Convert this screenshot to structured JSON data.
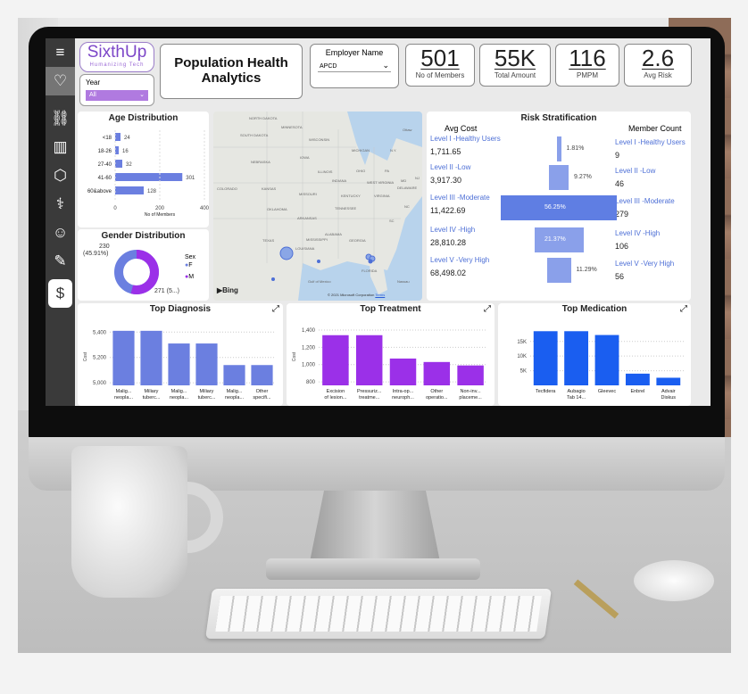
{
  "header": {
    "logo_text": "SixthUp",
    "logo_tagline": "Humanizing Tech",
    "title_line1": "Population Health",
    "title_line2": "Analytics",
    "year_label": "Year",
    "year_value": "All",
    "employer_label": "Employer Name",
    "employer_value": "APCD"
  },
  "kpis": [
    {
      "value": "501",
      "label": "No of Members"
    },
    {
      "value": "55K",
      "label": "Total Amount"
    },
    {
      "value": "116",
      "label": "PMPM"
    },
    {
      "value": "2.6",
      "label": "Avg Risk"
    }
  ],
  "sidebar": {
    "icons": [
      "menu-icon",
      "hand-heart-icon",
      "share-icon",
      "bar-chart-icon",
      "shield-icon",
      "stethoscope-icon",
      "doctor-icon",
      "notepad-icon",
      "money-bag-icon"
    ],
    "symbols": [
      "≡",
      "♡",
      "⛓",
      "▥",
      "⬡",
      "⚕",
      "☺",
      "✎",
      "$"
    ]
  },
  "age_chart": {
    "title": "Age Distribution",
    "xlabel": "No of Members",
    "ticks": [
      "0",
      "200",
      "400"
    ]
  },
  "gender_chart": {
    "title": "Gender Distribution",
    "label_f": "230",
    "label_f_pct": "(45.91%)",
    "label_m": "271 (5...)",
    "legend_title": "Sex",
    "legend_f": "F",
    "legend_m": "M"
  },
  "map": {
    "labels": [
      "NORTH DAKOTA",
      "MINNESOTA",
      "Ottaw",
      "SOUTH DAKOTA",
      "WISCONSIN",
      "MICHIGAN",
      "N.Y.",
      "IOWA",
      "NEBRASKA",
      "ILLINOIS",
      "OHIO",
      "PA",
      "INDIANA",
      "WEST VIRGINIA",
      "MD",
      "DELAWARE",
      "NJ",
      "COLORADO",
      "KANSAS",
      "MISSOURI",
      "KENTUCKY",
      "VIRGINIA",
      "NC",
      "TENNESSEE",
      "OKLAHOMA",
      "ARKANSAS",
      "SC",
      "ALABAMA",
      "TEXAS",
      "MISSISSIPPI",
      "GEORGIA",
      "LOUISIANA",
      "FLORIDA",
      "Gulf of Mexico",
      "Nassau"
    ],
    "bing": "Bing",
    "copyright": "© 2021 Microsoft Corporation",
    "terms": "Terms"
  },
  "risk": {
    "title": "Risk Stratification",
    "avg_cost_header": "Avg Cost",
    "member_count_header": "Member Count",
    "levels": [
      {
        "name": "Level I -Healthy Users",
        "cost": "1,711.65",
        "pct": "1.81%",
        "count": "9"
      },
      {
        "name": "Level II -Low",
        "cost": "3,917.30",
        "pct": "9.27%",
        "count": "46"
      },
      {
        "name": "Level III -Moderate",
        "cost": "11,422.69",
        "pct": "56.25%",
        "count": "279"
      },
      {
        "name": "Level IV -High",
        "cost": "28,810.28",
        "pct": "21.37%",
        "count": "106"
      },
      {
        "name": "Level V -Very High",
        "cost": "68,498.02",
        "pct": "11.29%",
        "count": "56"
      }
    ]
  },
  "colors": {
    "blue": "#6b7fe0",
    "purple": "#9b30e8",
    "darkblue": "#1a5ef0",
    "funnel": "#6a84e6"
  },
  "chart_data": [
    {
      "type": "bar",
      "title": "Age Distribution",
      "orientation": "horizontal",
      "categories": [
        "<18",
        "18-26",
        "27-40",
        "41-60",
        "60&above"
      ],
      "values": [
        24,
        16,
        32,
        301,
        128
      ],
      "xlabel": "No of Members",
      "xlim": [
        0,
        400
      ]
    },
    {
      "type": "pie",
      "title": "Gender Distribution",
      "categories": [
        "F",
        "M"
      ],
      "values": [
        230,
        271
      ]
    },
    {
      "type": "bar",
      "title": "Top Diagnosis",
      "categories": [
        "Malig... neopla...",
        "Miliary tuberc...",
        "Malig... neopla...",
        "Miliary tuberc...",
        "Malig... neopla...",
        "Other specifi..."
      ],
      "values": [
        5410,
        5410,
        5310,
        5310,
        5140,
        5140
      ],
      "ylabel": "Cost",
      "ylim": [
        4980,
        5430
      ],
      "yticks": [
        5000,
        5200,
        5400
      ],
      "ytick_labels": [
        "5,000",
        "5,200",
        "5,400"
      ]
    },
    {
      "type": "bar",
      "title": "Top Treatment",
      "categories": [
        "Excision of lesion...",
        "Pressuriz... treatme...",
        "Intra-op... neuroph...",
        "Other operatio...",
        "Non-inv... placeme..."
      ],
      "values": [
        1340,
        1340,
        1070,
        1030,
        990
      ],
      "ylabel": "Cost",
      "ylim": [
        760,
        1420
      ],
      "yticks": [
        800,
        1000,
        1200,
        1400
      ],
      "ytick_labels": [
        "800",
        "1,000",
        "1,200",
        "1,400"
      ]
    },
    {
      "type": "bar",
      "title": "Top Medication",
      "categories": [
        "Tecfidera",
        "Aubagio Tab 14...",
        "Gleevec",
        "Enbrel",
        "Advair Diskus"
      ],
      "values": [
        18500,
        18500,
        17200,
        4000,
        2600
      ],
      "ylabel": "",
      "ylim": [
        0,
        19500
      ],
      "yticks": [
        5000,
        10000,
        15000
      ],
      "ytick_labels": [
        "5K",
        "10K",
        "15K"
      ]
    }
  ]
}
